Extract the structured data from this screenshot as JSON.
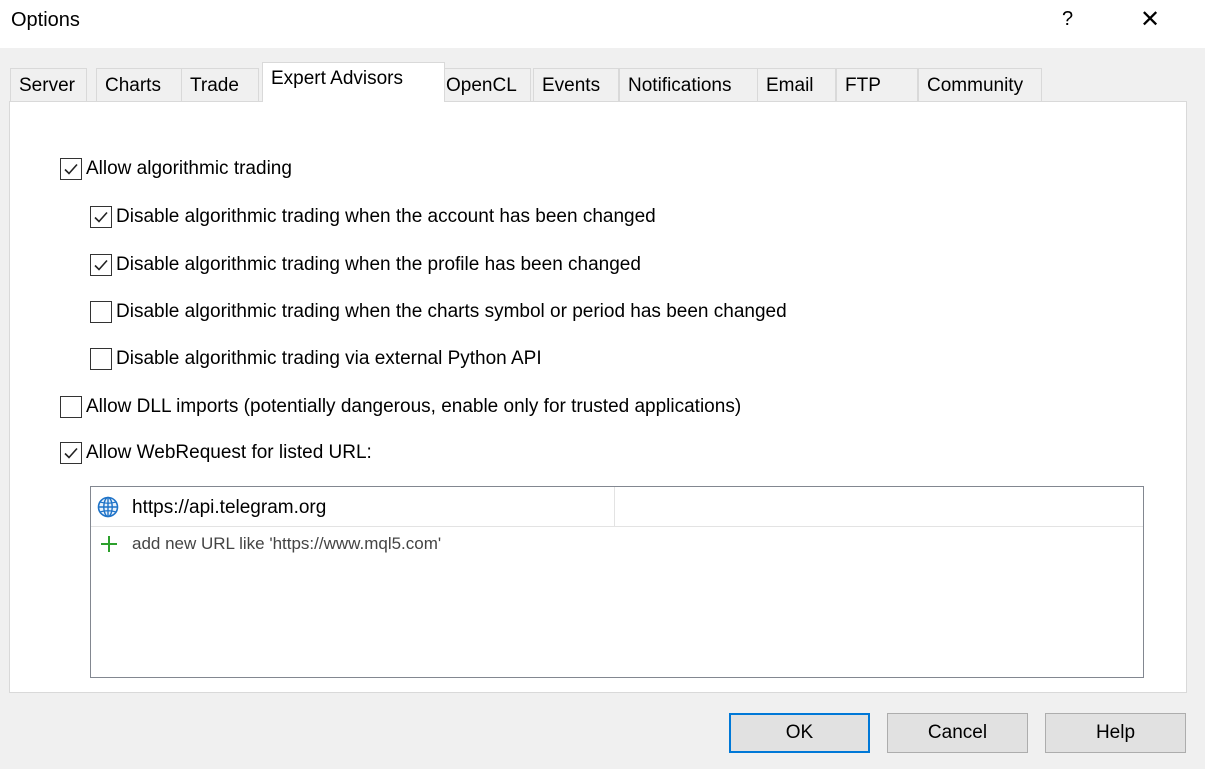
{
  "window": {
    "title": "Options",
    "help_glyph": "?",
    "close_glyph": "✕"
  },
  "tabs": [
    {
      "label": "Server",
      "active": false
    },
    {
      "label": "Charts",
      "active": false
    },
    {
      "label": "Trade",
      "active": false
    },
    {
      "label": "Expert Advisors",
      "active": true
    },
    {
      "label": "OpenCL",
      "active": false
    },
    {
      "label": "Events",
      "active": false
    },
    {
      "label": "Notifications",
      "active": false
    },
    {
      "label": "Email",
      "active": false
    },
    {
      "label": "FTP",
      "active": false
    },
    {
      "label": "Community",
      "active": false
    }
  ],
  "options": {
    "allow_algo": {
      "label": "Allow algorithmic trading",
      "checked": true
    },
    "disable_account": {
      "label": "Disable algorithmic trading when the account has been changed",
      "checked": true
    },
    "disable_profile": {
      "label": "Disable algorithmic trading when the profile has been changed",
      "checked": true
    },
    "disable_symbol": {
      "label": "Disable algorithmic trading when the charts symbol or period has been changed",
      "checked": false
    },
    "disable_python": {
      "label": "Disable algorithmic trading via external Python API",
      "checked": false
    },
    "allow_dll": {
      "label": "Allow DLL imports (potentially dangerous, enable only for trusted applications)",
      "checked": false
    },
    "allow_webrequest": {
      "label": "Allow WebRequest for listed URL:",
      "checked": true
    }
  },
  "url_list": {
    "items": [
      {
        "url": "https://api.telegram.org",
        "icon": "globe-icon"
      }
    ],
    "add_placeholder": "add new URL like 'https://www.mql5.com'",
    "add_icon": "plus-icon"
  },
  "buttons": {
    "ok": "OK",
    "cancel": "Cancel",
    "help": "Help"
  },
  "colors": {
    "accent": "#0078d7",
    "globe": "#1e73c8",
    "plus": "#2ca02c"
  }
}
